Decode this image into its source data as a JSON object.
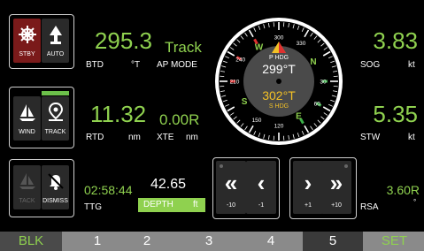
{
  "colors": {
    "accent_green": "#8fd14f",
    "stby_red": "#7a1a1a",
    "track_bar": "#6cc04a",
    "tab_active": "#3a3a3a",
    "tab_bar": "#8a8a8a"
  },
  "mode_panel": {
    "stby": {
      "label": "STBY",
      "icon": "helm-wheel-icon"
    },
    "auto": {
      "label": "AUTO",
      "icon": "autopilot-arrow-icon"
    }
  },
  "steer_panel": {
    "wind": {
      "label": "WIND",
      "icon": "sailboat-wind-icon"
    },
    "track": {
      "label": "TRACK",
      "icon": "waypoint-pin-icon"
    }
  },
  "alarm_panel": {
    "tack": {
      "label": "TACK",
      "icon": "tack-icon"
    },
    "dismiss": {
      "label": "DISMISS",
      "icon": "alarm-bell-icon"
    }
  },
  "btd": {
    "value": "295.3",
    "label": "BTD",
    "unit": "°T"
  },
  "ap_mode": {
    "value": "Track",
    "label": "AP MODE"
  },
  "rtd": {
    "value": "11.32",
    "label": "RTD",
    "unit": "nm"
  },
  "xte": {
    "value": "0.00R",
    "label": "XTE",
    "unit": "nm"
  },
  "ttg": {
    "value": "02:58:44",
    "label": "TTG"
  },
  "depth": {
    "value": "42.65",
    "label": "DEPTH",
    "unit": "ft"
  },
  "compass": {
    "p_hdg_label": "P HDG",
    "p_hdg_value": "299°T",
    "s_hdg_value": "302°T",
    "s_hdg_label": "S HDG",
    "heading_deg": 300,
    "ticks": [
      "300",
      "330",
      "30",
      "60",
      "120",
      "150",
      "210",
      "240"
    ],
    "cardinals": [
      "W",
      "N",
      "E",
      "S"
    ]
  },
  "nav_keys": [
    {
      "label": "-10",
      "glyph": "«",
      "icon": "double-chevron-left-icon"
    },
    {
      "label": "-1",
      "glyph": "‹",
      "icon": "chevron-left-icon"
    },
    {
      "label": "+1",
      "glyph": "›",
      "icon": "chevron-right-icon"
    },
    {
      "label": "+10",
      "glyph": "»",
      "icon": "double-chevron-right-icon"
    }
  ],
  "sog": {
    "value": "3.83",
    "label": "SOG",
    "unit": "kt"
  },
  "stw": {
    "value": "5.35",
    "label": "STW",
    "unit": "kt"
  },
  "rsa": {
    "value": "3.60R",
    "label": "RSA",
    "unit": "°"
  },
  "tabs": [
    "BLK",
    "1",
    "2",
    "3",
    "4",
    "5",
    "SET"
  ],
  "active_tab": "5"
}
